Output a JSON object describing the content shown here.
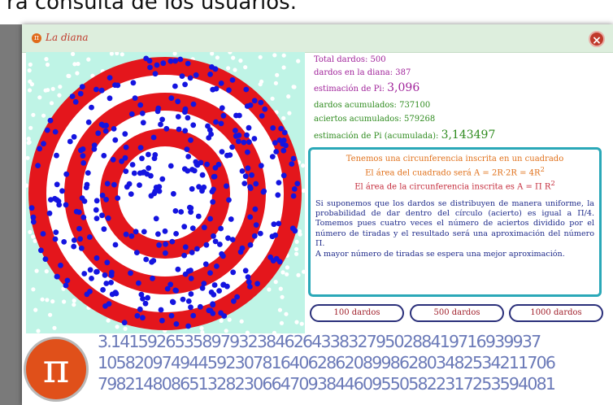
{
  "top_caption": "ra consulta de los usuarios.",
  "window": {
    "title": "La diana",
    "close_label": "×",
    "title_icon": "π"
  },
  "colors": {
    "ring_red": "#e4161c",
    "ring_white": "#ffffff",
    "background": "#bff4e6",
    "dart_blue": "#1414e0",
    "dart_white": "#ffffff",
    "frame_accent": "#2aa8b8",
    "pi_orange": "#e0501a"
  },
  "stats": {
    "total_label": "Total dardos:",
    "total_value": "500",
    "inside_label": "dardos en la diana:",
    "inside_value": "387",
    "pi_label": "estimación de Pi:",
    "pi_value": "3,096",
    "acc_darts_label": "dardos acumulados:",
    "acc_darts_value": "737100",
    "acc_hits_label": "aciertos acumulados:",
    "acc_hits_value": "579268",
    "acc_pi_label": "estimación de Pi (acumulada):",
    "acc_pi_value": "3,143497"
  },
  "explanation": {
    "line1": "Tenemos una circunferencia inscrita en un cuadrado",
    "line2_prefix": "El área del cuadrado será",
    "line2_formula": "A = 2R·2R = 4R",
    "line2_exp": "2",
    "line3_prefix": "El área de la circunferencia inscrita es",
    "line3_formula": "A = Π R",
    "line3_exp": "2",
    "paragraph1": "Si suponemos que los dardos se distribuyen de manera uniforme, la probabilidad de dar dentro del círculo (acierto) es igual a Π/4. Tomemos pues cuatro veces el número de aciertos dividido por el número de tiradas y el resultado será una aproximación del número Π.",
    "paragraph2": "A mayor número de tiradas se espera una mejor aproximación."
  },
  "buttons": {
    "b100": "100 dardos",
    "b500": "500 dardos",
    "b1000": "1000 dardos"
  },
  "pi_logo": "π",
  "pi_digits": {
    "line1": "3.14159265358979323846264338327950288419716939937",
    "line2": "10582097494459230781640628620899862803482534211706",
    "line3": "79821480865132823066470938446095505822317253594081"
  }
}
